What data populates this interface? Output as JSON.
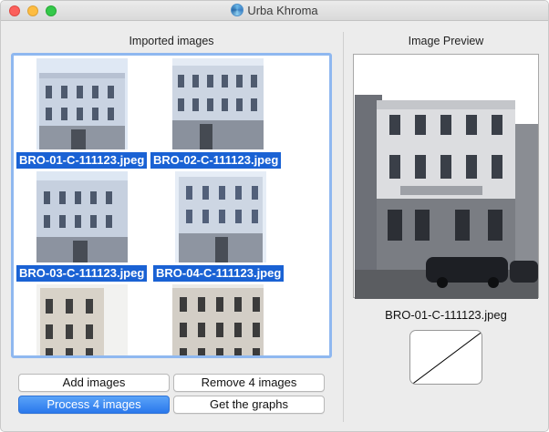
{
  "window": {
    "title": "Urba Khroma"
  },
  "left": {
    "header": "Imported images",
    "images": [
      {
        "name": "BRO-01-C-111123.jpeg",
        "selected": true
      },
      {
        "name": "BRO-02-C-111123.jpeg",
        "selected": true
      },
      {
        "name": "BRO-03-C-111123.jpeg",
        "selected": true
      },
      {
        "name": "BRO-04-C-111123.jpeg",
        "selected": true
      },
      {
        "name": "",
        "selected": false
      },
      {
        "name": "",
        "selected": false
      }
    ]
  },
  "right": {
    "header": "Image Preview",
    "preview_filename": "BRO-01-C-111123.jpeg"
  },
  "buttons": {
    "add": "Add images",
    "remove": "Remove 4 images",
    "process": "Process 4 images",
    "graphs": "Get the graphs"
  },
  "colors": {
    "selection": "#1a62d4",
    "primary_button": "#2a78ec",
    "list_focus_ring": "#8fb8f0"
  }
}
